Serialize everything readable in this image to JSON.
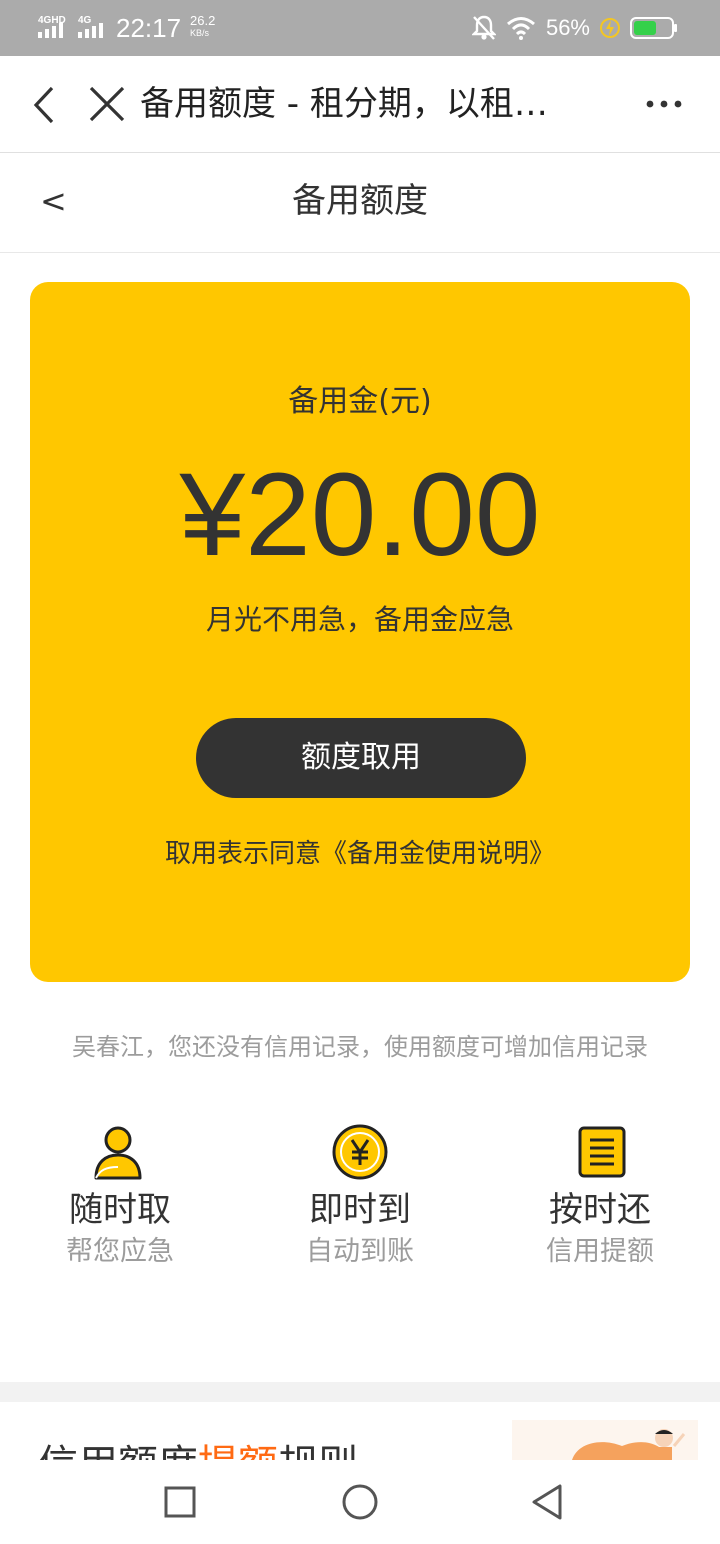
{
  "status_bar": {
    "network": "4GHD 4G",
    "time": "22:17",
    "speed_value": "26.2",
    "speed_unit": "KB/s",
    "battery": "56%",
    "battery_color": "#35d04a"
  },
  "webview": {
    "title": "备用额度 - 租分期，以租…"
  },
  "page": {
    "back_label": "<",
    "title": "备用额度"
  },
  "card": {
    "color": "#ffc700",
    "label": "备用金(元)",
    "amount": "¥20.00",
    "slogan": "月光不用急，备用金应急",
    "button": "额度取用",
    "agree_prefix": "取用表示同意",
    "agree_link": "《备用金使用说明》"
  },
  "notice": "吴春江，您还没有信用记录，使用额度可增加信用记录",
  "features": [
    {
      "icon": "user-icon",
      "title": "随时取",
      "subtitle": "帮您应急"
    },
    {
      "icon": "yen-coin-icon",
      "title": "即时到",
      "subtitle": "自动到账"
    },
    {
      "icon": "document-icon",
      "title": "按时还",
      "subtitle": "信用提额"
    }
  ],
  "rules": {
    "title_part1": "信用额度",
    "title_highlight": "提额",
    "title_part2": "规则"
  },
  "navbar": [
    "square-icon",
    "circle-icon",
    "triangle-back-icon"
  ]
}
